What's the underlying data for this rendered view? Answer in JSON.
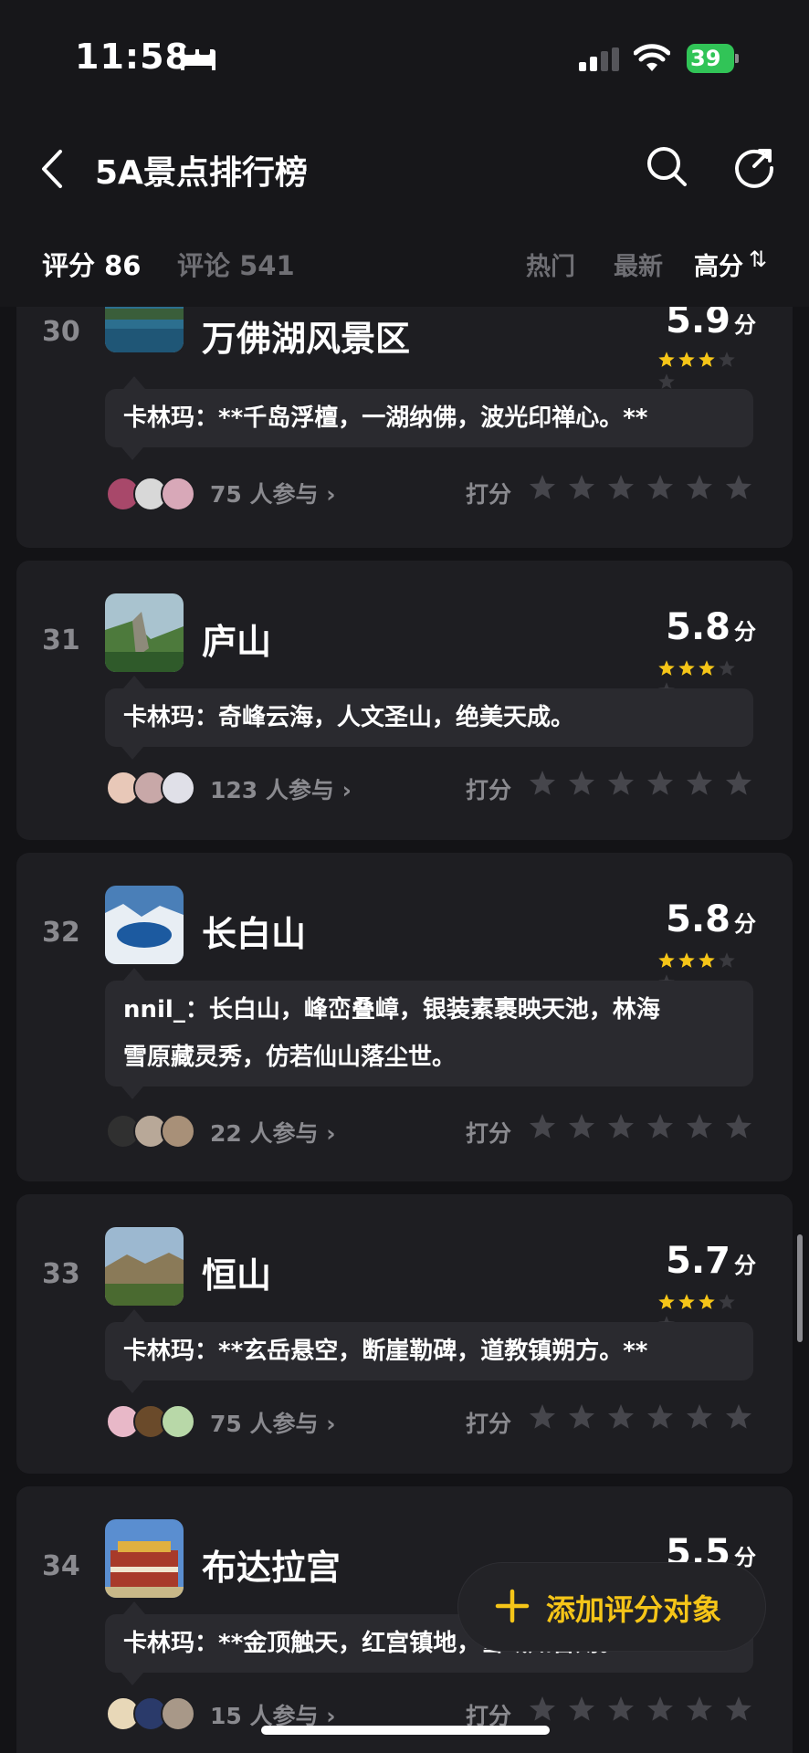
{
  "status_bar": {
    "time": "11:58",
    "battery": "39"
  },
  "nav": {
    "title": "5A景点排行榜"
  },
  "tabs": {
    "score": "评分 86",
    "comments": "评论 541"
  },
  "sort": {
    "hot": "热门",
    "new": "最新",
    "high": "高分",
    "arrow": "⇅"
  },
  "rate_label": "打分",
  "score_unit": "分",
  "items": [
    {
      "rank": "30",
      "name": "万佛湖风景区",
      "score": "5.9",
      "stars": 3,
      "comment_lines": [
        "卡林玛：**千岛浮檀，一湖纳佛，波光印禅心。**"
      ],
      "participants": "75 人参与 ›"
    },
    {
      "rank": "31",
      "name": "庐山",
      "score": "5.8",
      "stars": 3,
      "comment_lines": [
        "卡林玛：奇峰云海，人文圣山，绝美天成。"
      ],
      "participants": "123 人参与 ›"
    },
    {
      "rank": "32",
      "name": "长白山",
      "score": "5.8",
      "stars": 3,
      "comment_lines": [
        "nnil_：长白山，峰峦叠嶂，银装素裹映天池，林海",
        "雪原藏灵秀，仿若仙山落尘世。"
      ],
      "participants": "22 人参与 ›"
    },
    {
      "rank": "33",
      "name": "恒山",
      "score": "5.7",
      "stars": 3,
      "comment_lines": [
        "卡林玛：**玄岳悬空，断崖勒碑，道教镇朔方。**"
      ],
      "participants": "75 人参与 ›"
    },
    {
      "rank": "34",
      "name": "布达拉宫",
      "score": "5.5",
      "stars": 3,
      "comment_lines": [
        "卡林玛：**金顶触天，红宫镇地，雪域知音殇。**"
      ],
      "participants": "15 人参与 ›"
    }
  ],
  "add_button": {
    "label": "添加评分对象"
  },
  "colors": {
    "accent": "#f5c518",
    "background": "#131316",
    "card": "#1e1e22",
    "bubble": "#2a2a2f",
    "muted": "#8a8a8f"
  }
}
